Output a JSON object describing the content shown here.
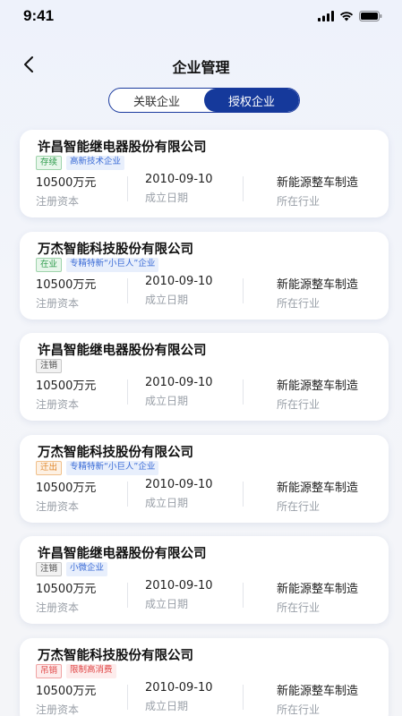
{
  "status_bar": {
    "time": "9:41"
  },
  "nav": {
    "title": "企业管理"
  },
  "tabs": [
    {
      "label": "关联企业",
      "active": false
    },
    {
      "label": "授权企业",
      "active": true
    }
  ],
  "labels": {
    "capital": "注册资本",
    "founded": "成立日期",
    "industry": "所在行业"
  },
  "companies": [
    {
      "name": "许昌智能继电器股份有限公司",
      "status": {
        "text": "存续",
        "color": "#2c9a4a",
        "bg": "#e7f6ea",
        "border": "#9ed3ab"
      },
      "tags": [
        {
          "text": "高新技术企业",
          "color": "#3a6bd6",
          "bg": "#e8effc"
        }
      ],
      "capital": "10500万元",
      "founded": "2010-09-10",
      "industry": "新能源整车制造"
    },
    {
      "name": "万杰智能科技股份有限公司",
      "status": {
        "text": "在业",
        "color": "#2c9a4a",
        "bg": "#e7f6ea",
        "border": "#9ed3ab"
      },
      "tags": [
        {
          "text": "专精特新“小巨人”企业",
          "color": "#3a6bd6",
          "bg": "#e8effc"
        }
      ],
      "capital": "10500万元",
      "founded": "2010-09-10",
      "industry": "新能源整车制造"
    },
    {
      "name": "许昌智能继电器股份有限公司",
      "status": {
        "text": "注销",
        "color": "#444444",
        "bg": "#f2f2f2",
        "border": "#c8c8c8"
      },
      "tags": [],
      "capital": "10500万元",
      "founded": "2010-09-10",
      "industry": "新能源整车制造"
    },
    {
      "name": "万杰智能科技股份有限公司",
      "status": {
        "text": "迁出",
        "color": "#e0862a",
        "bg": "#fdf1e4",
        "border": "#f0bf8a"
      },
      "tags": [
        {
          "text": "专精特新“小巨人”企业",
          "color": "#3a6bd6",
          "bg": "#e8effc"
        }
      ],
      "capital": "10500万元",
      "founded": "2010-09-10",
      "industry": "新能源整车制造"
    },
    {
      "name": "许昌智能继电器股份有限公司",
      "status": {
        "text": "注销",
        "color": "#444444",
        "bg": "#f2f2f2",
        "border": "#c8c8c8"
      },
      "tags": [
        {
          "text": "小微企业",
          "color": "#3a6bd6",
          "bg": "#e8effc"
        }
      ],
      "capital": "10500万元",
      "founded": "2010-09-10",
      "industry": "新能源整车制造"
    },
    {
      "name": "万杰智能科技股份有限公司",
      "status": {
        "text": "吊销",
        "color": "#e04545",
        "bg": "#fdecec",
        "border": "#f0a3a3"
      },
      "tags": [
        {
          "text": "限制高消费",
          "color": "#e04545",
          "bg": "#fdecec"
        }
      ],
      "capital": "10500万元",
      "founded": "2010-09-10",
      "industry": "新能源整车制造"
    }
  ]
}
